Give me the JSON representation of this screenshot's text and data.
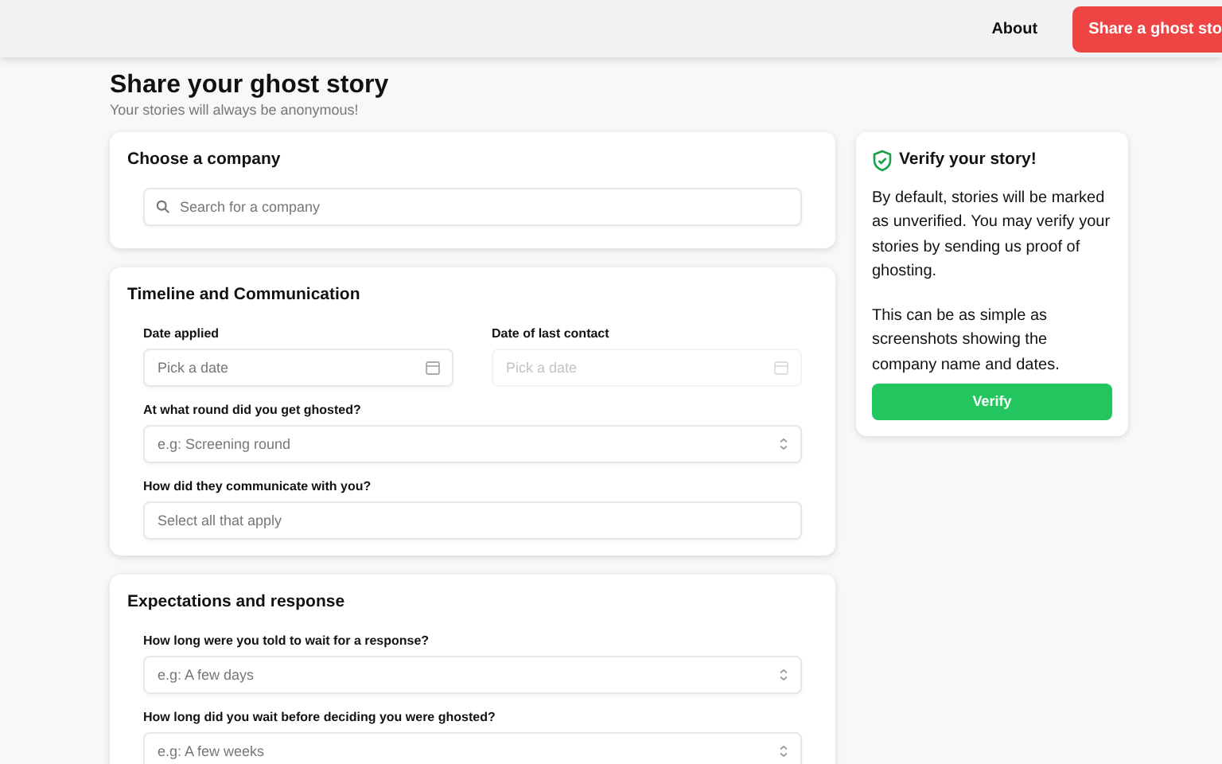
{
  "navbar": {
    "links": [
      {
        "label": "About",
        "kind": "link"
      },
      {
        "label": "Share a ghost sto",
        "kind": "button"
      }
    ]
  },
  "page": {
    "title": "Share your ghost story",
    "subtitle": "Your stories will always be anonymous!"
  },
  "cards": [
    {
      "title": "Choose a company",
      "fields": [
        {
          "kind": "search",
          "placeholder": "Search for a company",
          "disabled": false
        }
      ]
    },
    {
      "title": "Timeline and Communication",
      "fields": [
        {
          "kind": "date",
          "label": "Date applied",
          "placeholder": "Pick a date",
          "disabled": false
        },
        {
          "kind": "date",
          "label": "Date of last contact",
          "placeholder": "Pick a date",
          "disabled": true
        },
        {
          "kind": "select",
          "label": "At what round did you get ghosted?",
          "placeholder": "e.g: Screening round",
          "disabled": false
        },
        {
          "kind": "multiselect",
          "label": "How did they communicate with you?",
          "placeholder": "Select all that apply",
          "disabled": false
        }
      ]
    },
    {
      "title": "Expectations and response",
      "fields": [
        {
          "kind": "select",
          "label": "How long were you told to wait for a response?",
          "placeholder": "e.g: A few days",
          "disabled": false
        },
        {
          "kind": "select",
          "label": "How long did you wait before deciding you were ghosted?",
          "placeholder": "e.g: A few weeks",
          "disabled": false
        }
      ]
    }
  ],
  "verify_card": {
    "title": "Verify your story!",
    "paragraphs": [
      "By default, stories will be marked as unverified. You may verify your stories by sending us proof of ghosting.",
      "This can be as simple as screenshots showing the company name and dates."
    ],
    "button": "Verify"
  }
}
